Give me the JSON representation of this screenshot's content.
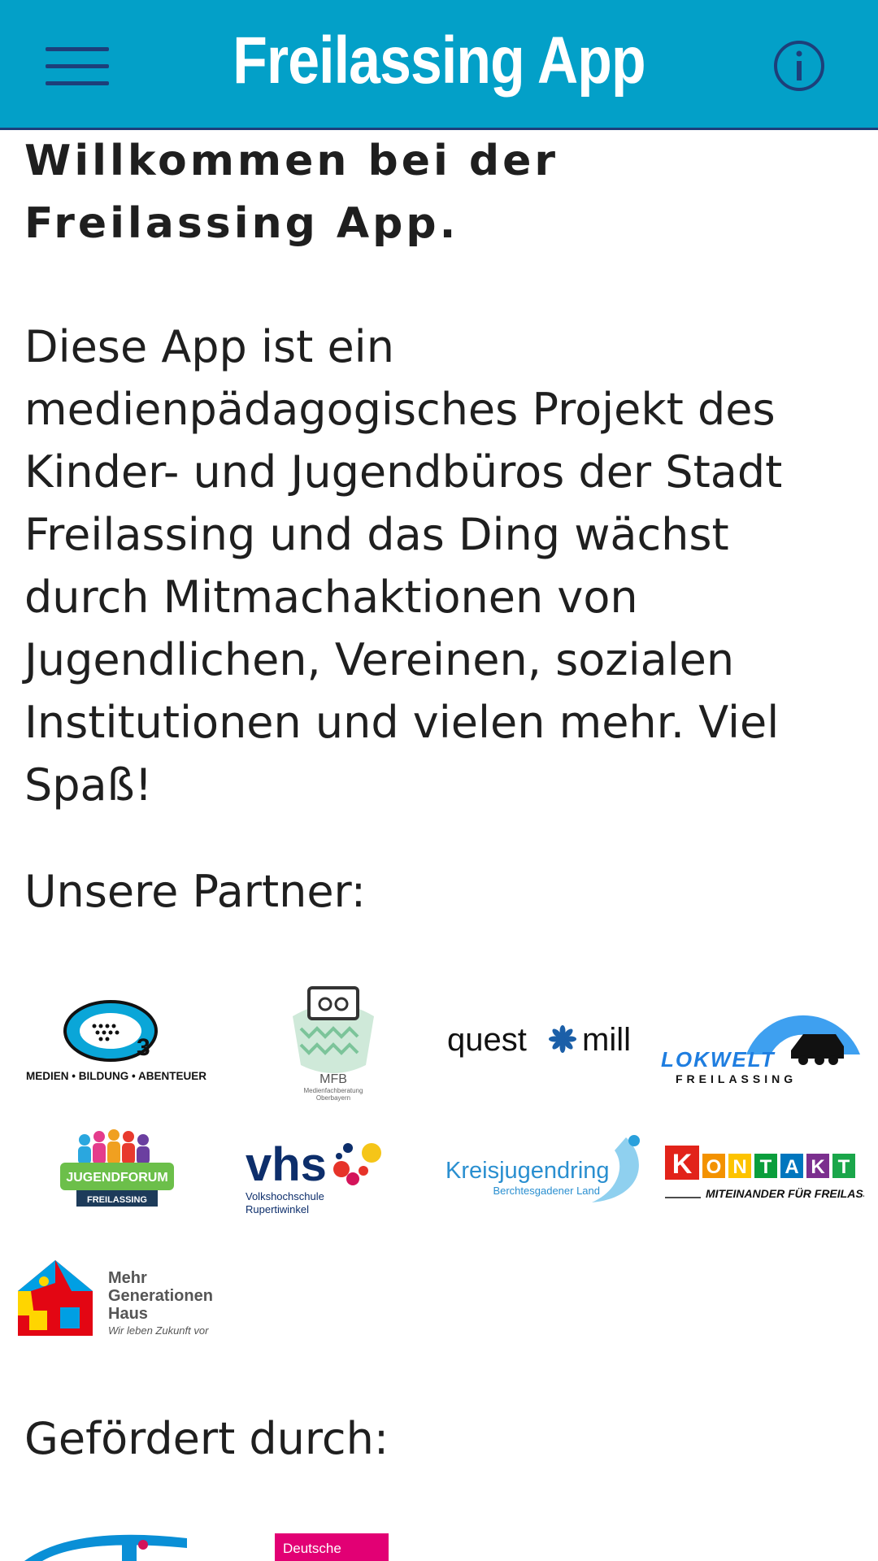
{
  "header": {
    "title": "Freilassing App",
    "bg_color": "#03A0C8",
    "accent_color": "#1d3f7a",
    "menu_icon": "hamburger-menu-icon",
    "info_icon": "info-icon"
  },
  "content": {
    "welcome": "Willkommen bei der Freilassing App.",
    "description": "Diese App ist ein medienpädagogisches Projekt des Kinder- und Jugendbüros der Stadt Freilassing und das Ding wächst durch Mitmachaktionen von Jugendlichen, Vereinen, sozialen Institutionen und vielen mehr. Viel Spaß!",
    "partners_heading": "Unsere Partner:",
    "sponsors_heading": "Gefördert durch:"
  },
  "partners": {
    "q3": "MEDIEN • BILDUNG • ABENTEUER",
    "mfb": "MFB",
    "mfb_sub1": "Medienfachberatung",
    "mfb_sub2": "Oberbayern",
    "questmill_a": "quest",
    "questmill_b": "mill",
    "lokwelt": "LOKWELT",
    "lokwelt_sub": "FREILASSING",
    "jugendforum": "JUGENDFORUM",
    "jugendforum_sub": "FREILASSING",
    "vhs": "vhs",
    "vhs_sub1": "Volkshochschule",
    "vhs_sub2": "Rupertiwinkel",
    "kjr": "Kreisjugendring",
    "kjr_sub": "Berchtesgadener Land",
    "kontakt_sub": "MITEINANDER FÜR FREILASSING",
    "mgh1": "Mehr",
    "mgh2": "Generationen",
    "mgh3": "Haus",
    "mgh4": "Wir leben Zukunft vor"
  },
  "sponsors": {
    "telekom": "Deutsche"
  }
}
